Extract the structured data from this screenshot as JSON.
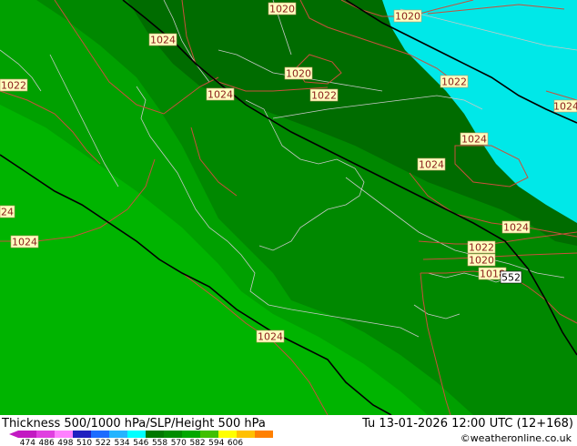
{
  "footer": {
    "title": "Thickness 500/1000 hPa/SLP/Height 500 hPa",
    "valid_time": "Tu 13-01-2026 12:00 UTC (12+168)",
    "credit": "©weatheronline.co.uk"
  },
  "scale": {
    "ticks": [
      "474",
      "486",
      "498",
      "510",
      "522",
      "534",
      "546",
      "558",
      "570",
      "582",
      "594",
      "606"
    ],
    "colors": [
      "#c21ac2",
      "#e040e0",
      "#ff80ff",
      "#2020c0",
      "#1c6cff",
      "#24b4ff",
      "#00ffff",
      "#007800",
      "#008c00",
      "#00a800",
      "#40c000",
      "#ffff00",
      "#ffc000",
      "#ff8000"
    ]
  },
  "map_colors": {
    "thickness_534": "#006c00",
    "thickness_540": "#008800",
    "thickness_546": "#00a000",
    "thickness_552": "#00b400",
    "thickness_528": "#00e8e8",
    "isobar": "#c8503c",
    "height": "#000000",
    "coast": "#c8c8c8"
  },
  "isobar_labels": [
    {
      "text": "1020"
    },
    {
      "text": "1020"
    },
    {
      "text": "1024"
    },
    {
      "text": "1020"
    },
    {
      "text": "1024"
    },
    {
      "text": "1022"
    },
    {
      "text": "1022"
    },
    {
      "text": "1022"
    },
    {
      "text": "1024"
    },
    {
      "text": "1024"
    },
    {
      "text": "1024"
    },
    {
      "text": "24"
    },
    {
      "text": "1024"
    },
    {
      "text": "1022"
    },
    {
      "text": "1020"
    },
    {
      "text": "1018"
    },
    {
      "text": "1024"
    },
    {
      "text": "1024"
    }
  ],
  "height_labels": [
    {
      "text": "552"
    }
  ]
}
